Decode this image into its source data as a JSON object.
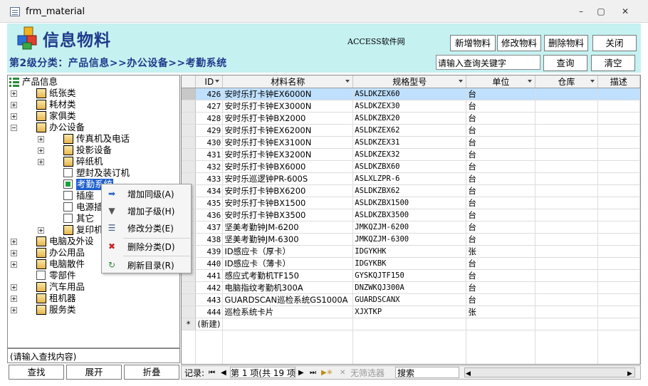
{
  "window": {
    "title": "frm_material",
    "min": "–",
    "max": "▢",
    "close": "✕"
  },
  "header": {
    "app_title": "信息物料",
    "access_text": "ACCESS软件网"
  },
  "toolbar": {
    "add_label": "新增物料",
    "edit_label": "修改物料",
    "delete_label": "删除物料",
    "close_label": "关闭"
  },
  "breadcrumb": "第2级分类：产品信息>>办公设备>>考勤系统",
  "search": {
    "placeholder": "请输入查询关键字",
    "query_label": "查询",
    "clear_label": "清空"
  },
  "tree": {
    "root": "产品信息",
    "nodes": [
      {
        "label": "纸张类"
      },
      {
        "label": "耗材类"
      },
      {
        "label": "家俱类"
      },
      {
        "label": "办公设备"
      },
      {
        "label": "传真机及电话"
      },
      {
        "label": "投影设备"
      },
      {
        "label": "碎纸机"
      },
      {
        "label": "塑封及装订机"
      },
      {
        "label": "考勤系统"
      },
      {
        "label": "插座"
      },
      {
        "label": "电源插"
      },
      {
        "label": "其它"
      },
      {
        "label": "复印机"
      },
      {
        "label": "电脑及外设"
      },
      {
        "label": "办公用品"
      },
      {
        "label": "电脑散件"
      },
      {
        "label": "零部件"
      },
      {
        "label": "汽车用品"
      },
      {
        "label": "租机器"
      },
      {
        "label": "服务类"
      }
    ],
    "search_placeholder": "(请输入查找内容)",
    "find_label": "查找",
    "expand_label": "展开",
    "collapse_label": "折叠"
  },
  "context_menu": [
    {
      "label": "增加同级(A)"
    },
    {
      "label": "增加子级(H)"
    },
    {
      "label": "修改分类(E)"
    },
    {
      "label": "删除分类(D)"
    },
    {
      "label": "刷新目录(R)"
    }
  ],
  "grid": {
    "columns": [
      "ID",
      "材料名称",
      "规格型号",
      "单位",
      "仓库",
      "描述"
    ],
    "rows": [
      [
        "426",
        "安时乐打卡钟EX6000N",
        "ASLDKZEX60",
        "台"
      ],
      [
        "427",
        "安时乐打卡钟EX3000N",
        "ASLDKZEX30",
        "台"
      ],
      [
        "428",
        "安时乐打卡钟BX2000",
        "ASLDKZBX20",
        "台"
      ],
      [
        "429",
        "安时乐打卡钟EX6200N",
        "ASLDKZEX62",
        "台"
      ],
      [
        "430",
        "安时乐打卡钟EX3100N",
        "ASLDKZEX31",
        "台"
      ],
      [
        "431",
        "安时乐打卡钟EX3200N",
        "ASLDKZEX32",
        "台"
      ],
      [
        "432",
        "安时乐打卡钟BX6000",
        "ASLDKZBX60",
        "台"
      ],
      [
        "433",
        "安时乐巡逻钟PR-600S",
        "ASLXLZPR-6",
        "台"
      ],
      [
        "434",
        "安时乐打卡钟BX6200",
        "ASLDKZBX62",
        "台"
      ],
      [
        "435",
        "安时乐打卡钟BX1500",
        "ASLDKZBX1500",
        "台"
      ],
      [
        "436",
        "安时乐打卡钟BX3500",
        "ASLDKZBX3500",
        "台"
      ],
      [
        "437",
        "坚美考勤钟JM-6200",
        "JMKQZJM-6200",
        "台"
      ],
      [
        "438",
        "坚美考勤钟JM-6300",
        "JMKQZJM-6300",
        "台"
      ],
      [
        "439",
        "ID感应卡（厚卡）",
        "IDGYKHK",
        "张"
      ],
      [
        "440",
        "ID感应卡（薄卡）",
        "IDGYKBK",
        "台"
      ],
      [
        "441",
        "感应式考勤机TF150",
        "GYSKQJTF150",
        "台"
      ],
      [
        "442",
        "电脑指纹考勤机300A",
        "DNZWKQJ300A",
        "台"
      ],
      [
        "443",
        "GUARDSCAN巡检系统GS1000A",
        "GUARDSCANX",
        "台"
      ],
      [
        "444",
        "巡检系统卡片",
        "XJXTKP",
        "张"
      ]
    ],
    "new_row_marker": "*",
    "new_row_label": "(新建)"
  },
  "status": {
    "record_label": "记录:",
    "record_text": "第 1 项(共 19 项",
    "filter_label": "无筛选器",
    "search_label": "搜索"
  }
}
